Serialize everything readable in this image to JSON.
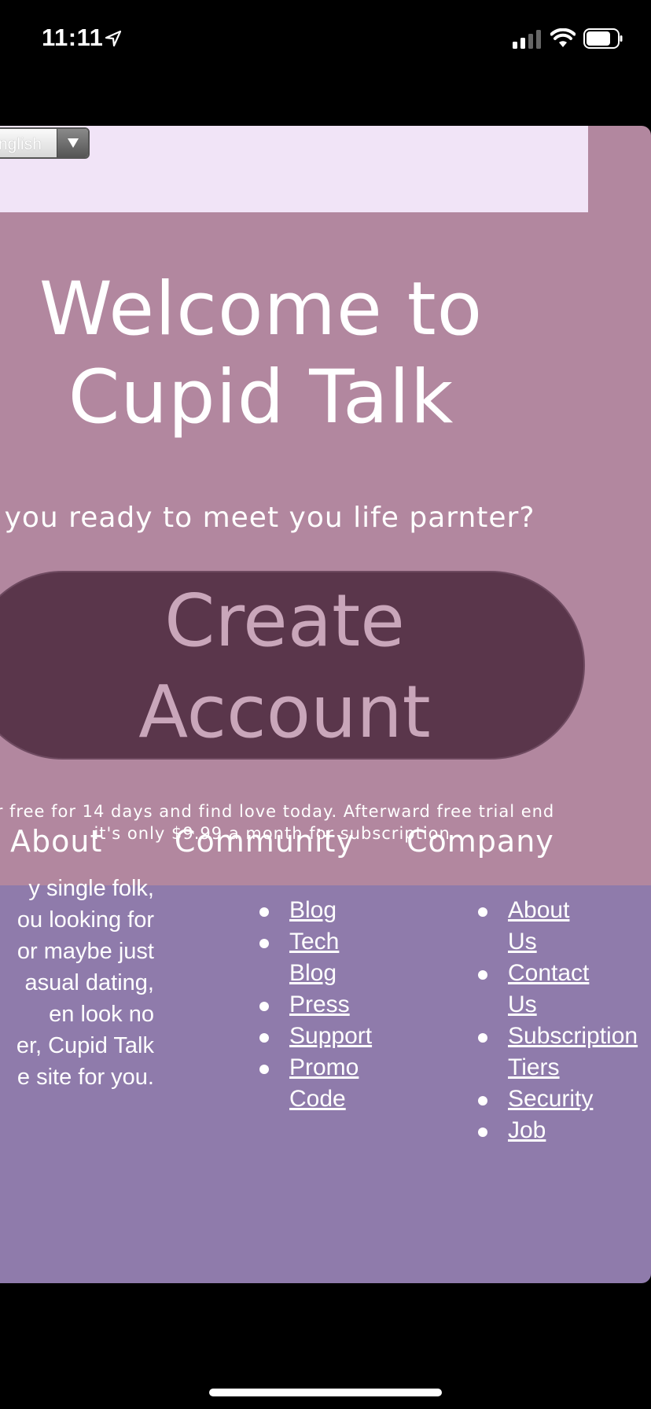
{
  "status_bar": {
    "time": "11:11",
    "icons": [
      "location-arrow-icon",
      "cellular-signal-icon",
      "wifi-icon",
      "battery-icon"
    ]
  },
  "language_select": {
    "value": "nglish"
  },
  "hero": {
    "title_line1": "Welcome to",
    "title_line2": "Cupid Talk",
    "tagline": "e you ready to meet you life parnter?",
    "cta_line1": "Create",
    "cta_line2": "Account",
    "trial_line1": "r free for 14 days and find love today. Afterward free trial end",
    "trial_line2": "it's only $9.99 a month for subscription."
  },
  "footer": {
    "about": {
      "heading": "About",
      "text_lines": [
        "y single folk,",
        "ou looking for",
        "or maybe just",
        "asual dating,",
        "en look no",
        "er, Cupid Talk",
        "e site for you."
      ]
    },
    "community": {
      "heading": "Community",
      "links": [
        {
          "line1": "Blog",
          "line2": ""
        },
        {
          "line1": "Tech",
          "line2": "Blog"
        },
        {
          "line1": "Press",
          "line2": ""
        },
        {
          "line1": "Support",
          "line2": ""
        },
        {
          "line1": "Promo",
          "line2": "Code"
        }
      ]
    },
    "company": {
      "heading": "Company",
      "links": [
        {
          "line1": "About",
          "line2": "Us"
        },
        {
          "line1": "Contact",
          "line2": "Us"
        },
        {
          "line1": "Subscription",
          "line2": "Tiers"
        },
        {
          "line1": "Security",
          "line2": ""
        },
        {
          "line1": "Job",
          "line2": ""
        }
      ]
    }
  },
  "colors": {
    "hero_bg": "#b2879f",
    "lang_bar_bg": "#f1e4f7",
    "cta_bg": "#5a364b",
    "cta_text": "#c9a6ba",
    "footer_bg": "#8f7bab"
  }
}
